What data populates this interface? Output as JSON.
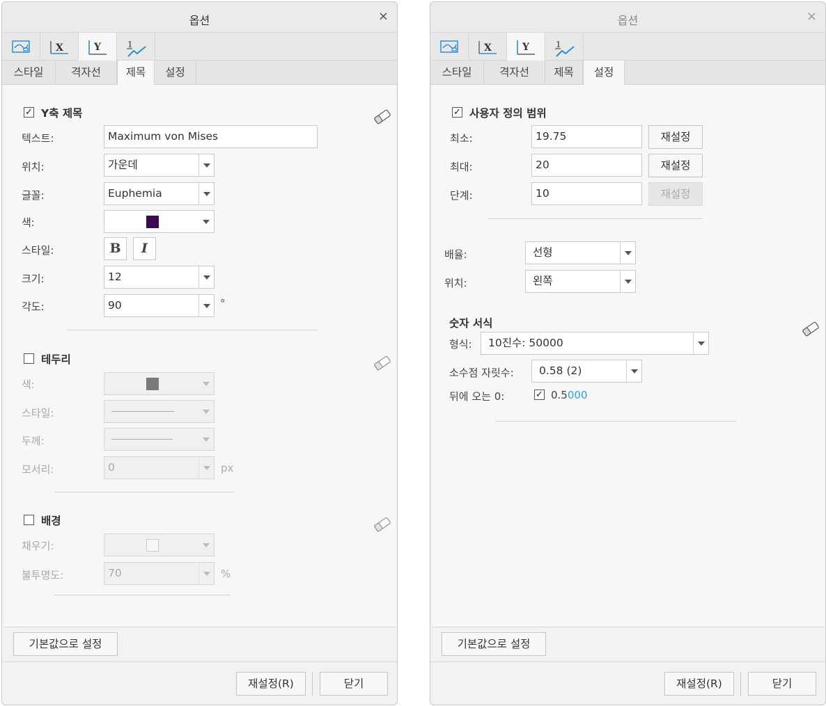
{
  "left_dialog": {
    "title": "옵션",
    "close_glyph": "×",
    "icon_tabs": [
      "chart-style-icon",
      "x-axis-icon",
      "y-axis-icon",
      "series-icon"
    ],
    "icon_tab_labels": {
      "x": "X",
      "y": "Y",
      "series": "1"
    },
    "text_tabs": [
      "스타일",
      "격자선",
      "제목",
      "설정"
    ],
    "selected_icon_tab": "y-axis-icon",
    "selected_text_tab": "제목",
    "title_section": {
      "header": "Y축 제목",
      "checked": true,
      "text_label": "텍스트:",
      "text_value": "Maximum von Mises",
      "position_label": "위치:",
      "position_value": "가운데",
      "font_label": "글꼴:",
      "font_value": "Euphemia",
      "color_label": "색:",
      "color_value": "#3c0a55",
      "style_label": "스타일:",
      "bold_glyph": "B",
      "italic_glyph": "I",
      "size_label": "크기:",
      "size_value": "12",
      "angle_label": "각도:",
      "angle_value": "90",
      "angle_unit": "°"
    },
    "border_section": {
      "header": "테두리",
      "checked": false,
      "color_label": "색:",
      "color_value": "#7a7a7a",
      "style_label": "스타일:",
      "thickness_label": "두께:",
      "corner_label": "모서리:",
      "corner_value": "0",
      "corner_unit": "px"
    },
    "background_section": {
      "header": "배경",
      "checked": false,
      "fill_label": "채우기:",
      "opacity_label": "불투명도:",
      "opacity_value": "70",
      "opacity_unit": "%"
    },
    "defaults_button": "기본값으로 설정",
    "reset_button": "재설정(R)",
    "close_button": "닫기"
  },
  "right_dialog": {
    "title": "옵션",
    "close_glyph": "×",
    "text_tabs": [
      "스타일",
      "격자선",
      "제목",
      "설정"
    ],
    "selected_text_tab": "설정",
    "range_section": {
      "header": "사용자 정의 범위",
      "checked": true,
      "min_label": "최소:",
      "min_value": "19.75",
      "max_label": "최대:",
      "max_value": "20",
      "step_label": "단계:",
      "step_value": "10",
      "reset_label": "재설정"
    },
    "scale_label": "배율:",
    "scale_value": "선형",
    "position_label": "위치:",
    "position_value": "왼쪽",
    "number_format": {
      "header": "숫자 서식",
      "format_label": "형식:",
      "format_value": "10진수: 50000",
      "decimals_label": "소수점 자릿수:",
      "decimals_value": "0.58 (2)",
      "trailing_label": "뒤에 오는 0:",
      "trailing_checked": true,
      "trailing_preview_base": "0.5",
      "trailing_preview_zeros": "000",
      "zeros_color": "#2aa3e8"
    },
    "defaults_button": "기본값으로 설정",
    "reset_button": "재설정(R)",
    "close_button": "닫기"
  }
}
